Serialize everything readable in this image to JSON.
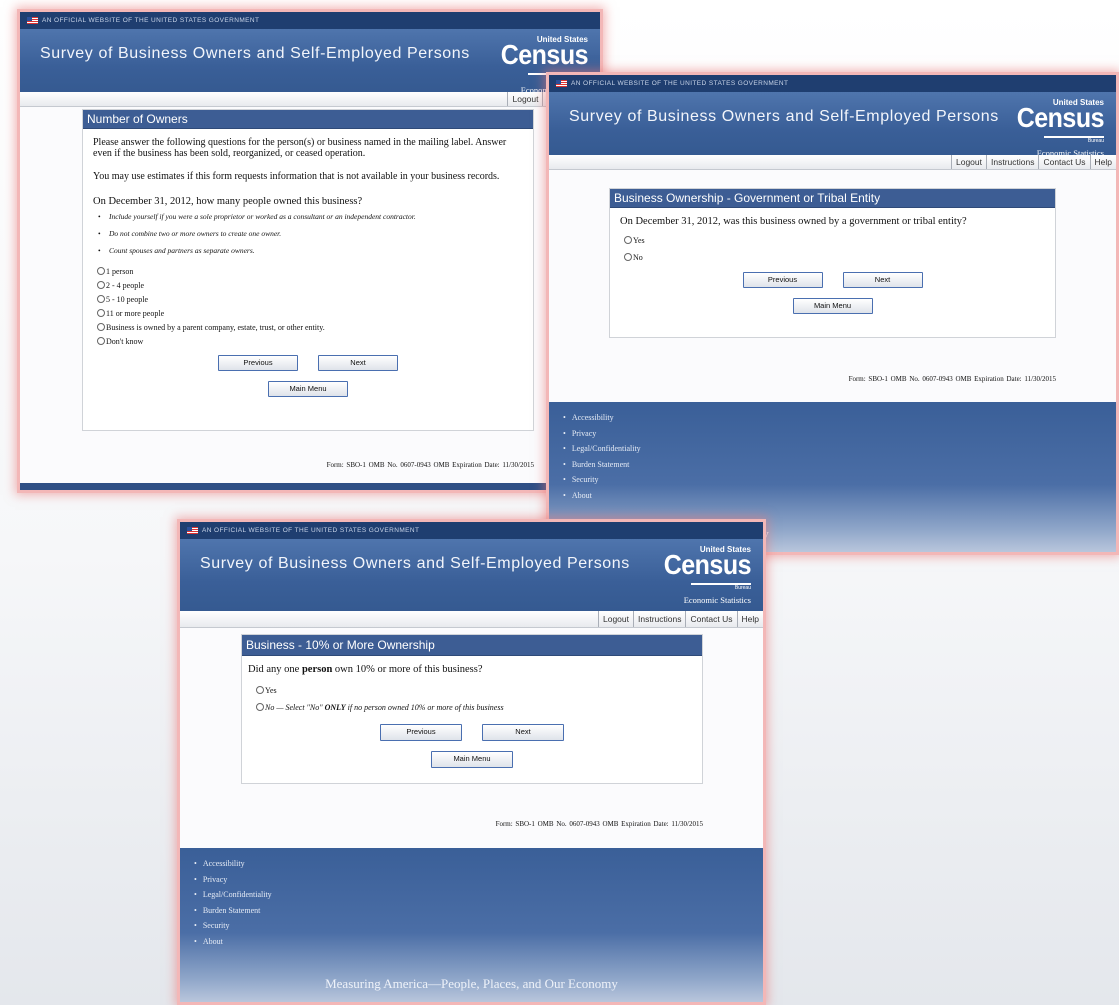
{
  "gov_banner": "An official website of the United States Government",
  "site_title": "Survey of Business Owners and Self-Employed Persons",
  "logo": {
    "top": "United States",
    "name": "Census",
    "bureau": "Bureau",
    "sub": "Economic Statistics"
  },
  "nav": [
    "Logout",
    "Instructions",
    "Contact Us",
    "Help"
  ],
  "form_footer": "Form: SBO-1   OMB No. 0607-0943   OMB Expiration Date: 11/30/2015",
  "footer_links": [
    "Accessibility",
    "Privacy",
    "Legal/Confidentiality",
    "Burden Statement",
    "Security",
    "About"
  ],
  "tagline": "Measuring America—People, Places, and Our Economy",
  "buttons": {
    "previous": "Previous",
    "next": "Next",
    "main_menu": "Main Menu"
  },
  "screen1": {
    "heading": "Number of Owners",
    "para1": "Please answer the following questions for the person(s) or business named in the mailing label. Answer even if the business has been sold, reorganized, or ceased operation.",
    "para2": "You may use estimates if this form requests information that is not available in your business records.",
    "question": "On December 31, 2012, how many people owned this business?",
    "bullets": [
      "Include yourself if you were a sole proprietor or worked as a consultant or an independent contractor.",
      "Do not combine two or more owners to create one owner.",
      "Count spouses and partners as separate owners."
    ],
    "options": [
      "1 person",
      "2 - 4 people",
      "5 - 10 people",
      "11 or more people",
      "Business is owned by a parent company, estate, trust, or other entity.",
      "Don't know"
    ]
  },
  "screen2": {
    "heading": "Business Ownership - Government or Tribal Entity",
    "question": "On December 31, 2012, was this business owned by a government or tribal entity?",
    "options": [
      "Yes",
      "No"
    ]
  },
  "screen3": {
    "heading": "Business - 10% or More Ownership",
    "question_pre": "Did any one ",
    "question_bold": "person",
    "question_post": " own 10% or more of this business?",
    "option_yes": "Yes",
    "option_no_pre": "No — Select \"No\" ",
    "option_no_bold": "ONLY",
    "option_no_post": " if no person owned 10% or more of this business"
  },
  "colors": {
    "header_blue": "#3a5f98",
    "gov_bar": "#1f3e70",
    "panel_header": "#3d5d94",
    "highlight_glow": "#e87878"
  }
}
